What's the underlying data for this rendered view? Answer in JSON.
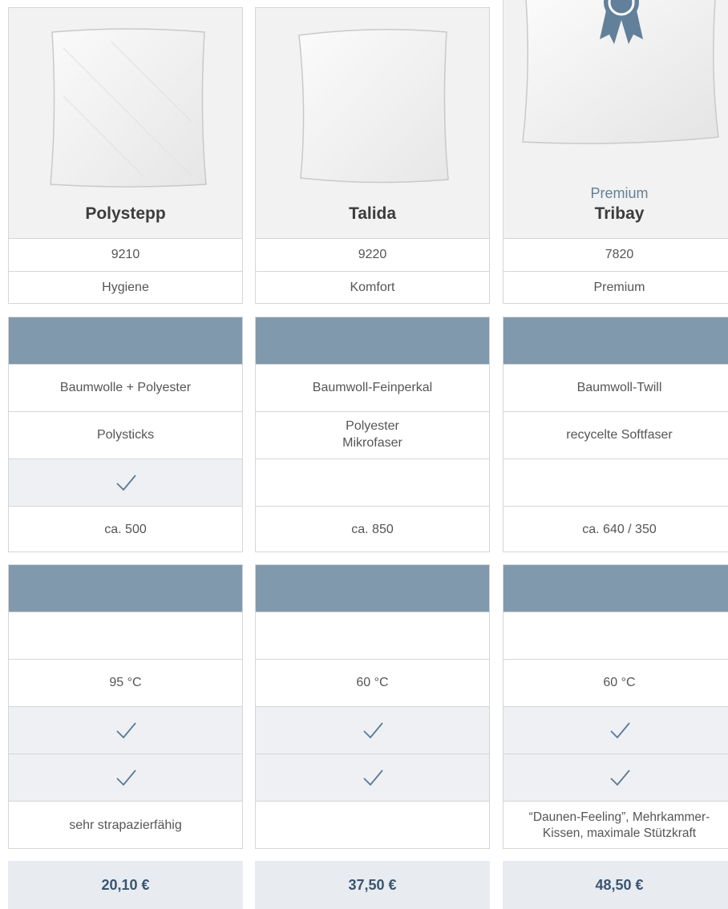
{
  "products": [
    {
      "name": "Polystepp",
      "label": "",
      "number": "9210",
      "category": "Hygiene",
      "fabric": "Baumwolle + Polyester",
      "filling": "Polysticks",
      "check_row3": true,
      "weight": "ca. 500",
      "temperature": "95 °C",
      "check_row_a": true,
      "check_row_b": true,
      "note": "sehr strapazierfähig",
      "price": "20,10 €"
    },
    {
      "name": "Talida",
      "label": "",
      "number": "9220",
      "category": "Komfort",
      "fabric": "Baumwoll-Feinperkal",
      "filling": "Polyester\nMikrofaser",
      "check_row3": false,
      "weight": "ca. 850",
      "temperature": "60 °C",
      "check_row_a": true,
      "check_row_b": true,
      "note": "",
      "price": "37,50 €"
    },
    {
      "name": "Tribay",
      "label": "Premium",
      "badge": "award-ribbon-icon",
      "number": "7820",
      "category": "Premium",
      "fabric": "Baumwoll-Twill",
      "filling": "recycelte Softfaser",
      "check_row3": false,
      "weight": "ca. 640 / 350",
      "temperature": "60 °C",
      "check_row_a": true,
      "check_row_b": true,
      "note": "“Daunen-Feeling”, Mehrkammer-\nKissen, maximale Stützkraft",
      "price": "48,50 €"
    }
  ],
  "colors": {
    "header_band": "#8199ac",
    "accent": "#62809a",
    "check": "#5a7a96",
    "price_bg": "#e8ecf0",
    "price_text": "#3b5470"
  }
}
